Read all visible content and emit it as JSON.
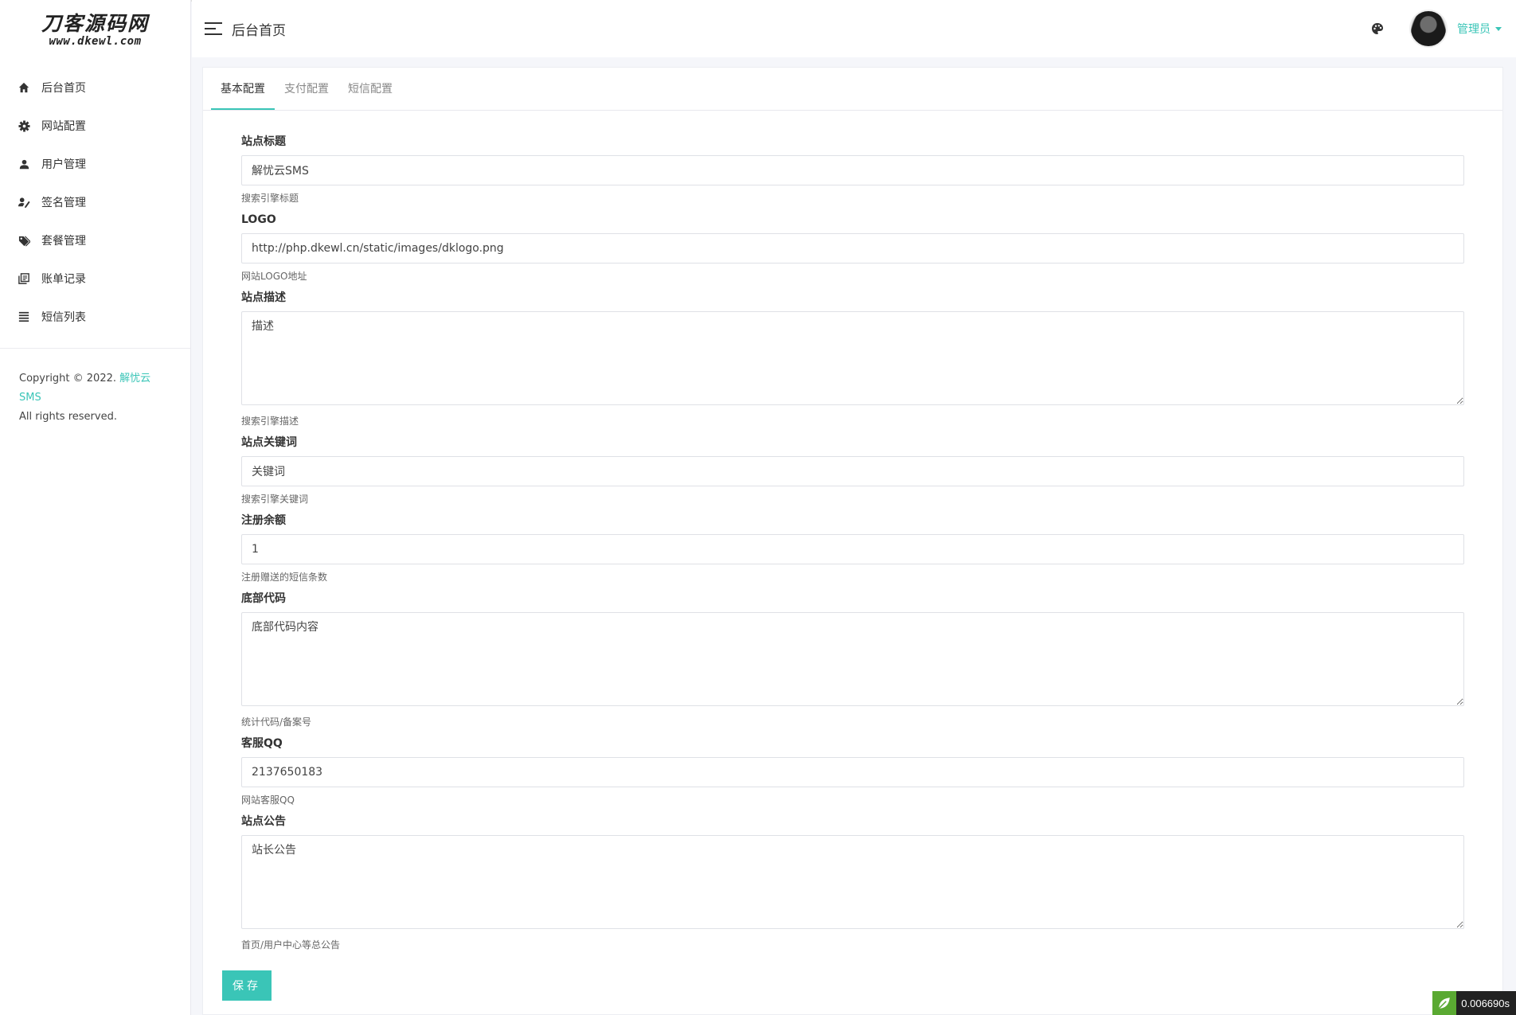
{
  "logo": {
    "main": "刀客源码网",
    "sub": "www.dkewl.com"
  },
  "sidebar": {
    "items": [
      {
        "label": "后台首页",
        "icon": "home-icon"
      },
      {
        "label": "网站配置",
        "icon": "gear-icon"
      },
      {
        "label": "用户管理",
        "icon": "user-icon"
      },
      {
        "label": "签名管理",
        "icon": "signature-icon"
      },
      {
        "label": "套餐管理",
        "icon": "tags-icon"
      },
      {
        "label": "账单记录",
        "icon": "bill-icon"
      },
      {
        "label": "短信列表",
        "icon": "list-icon"
      }
    ],
    "copyright_prefix": "Copyright © 2022.",
    "copyright_link": "解忧云SMS",
    "copyright_suffix": "All rights reserved."
  },
  "header": {
    "title": "后台首页",
    "user_name": "管理员"
  },
  "tabs": [
    "基本配置",
    "支付配置",
    "短信配置"
  ],
  "form": {
    "fields": [
      {
        "label": "站点标题",
        "value": "解忧云SMS",
        "help": "搜索引擎标题"
      },
      {
        "label": "LOGO",
        "value": "http://php.dkewl.cn/static/images/dklogo.png",
        "help": "网站LOGO地址"
      },
      {
        "label": "站点描述",
        "value": "描述",
        "help": "搜索引擎描述"
      },
      {
        "label": "站点关键词",
        "value": "关键词",
        "help": "搜索引擎关键词"
      },
      {
        "label": "注册余额",
        "value": "1",
        "help": "注册赠送的短信条数"
      },
      {
        "label": "底部代码",
        "value": "底部代码内容",
        "help": "统计代码/备案号"
      },
      {
        "label": "客服QQ",
        "value": "2137650183",
        "help": "网站客服QQ"
      },
      {
        "label": "站点公告",
        "value": "站长公告",
        "help": "首页/用户中心等总公告"
      }
    ],
    "save_label": "保存"
  },
  "timer": "0.006690s",
  "colors": {
    "accent": "#3ac5b7"
  }
}
